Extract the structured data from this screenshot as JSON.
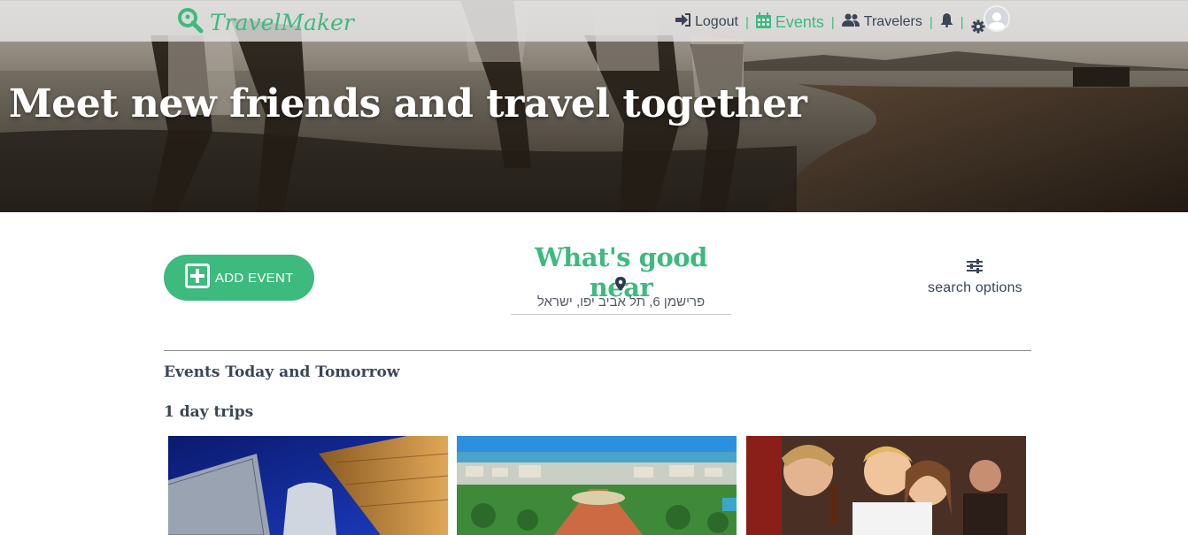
{
  "nav": {
    "brand": "TravelMaker",
    "logout": "Logout",
    "events": "Events",
    "travelers": "Travelers",
    "separator": "|"
  },
  "hero": {
    "title": "Meet new friends and travel together"
  },
  "main": {
    "add_event_label": "ADD EVENT",
    "near_title": "What's good near",
    "address": "פרישמן 6, תל אביב יפו, ישראל",
    "search_options_label": "search options"
  },
  "sections": {
    "today": "Events Today and Tomorrow",
    "day_trips": "1 day trips"
  },
  "colors": {
    "accent": "#3dba7e",
    "text": "#3a4556"
  }
}
